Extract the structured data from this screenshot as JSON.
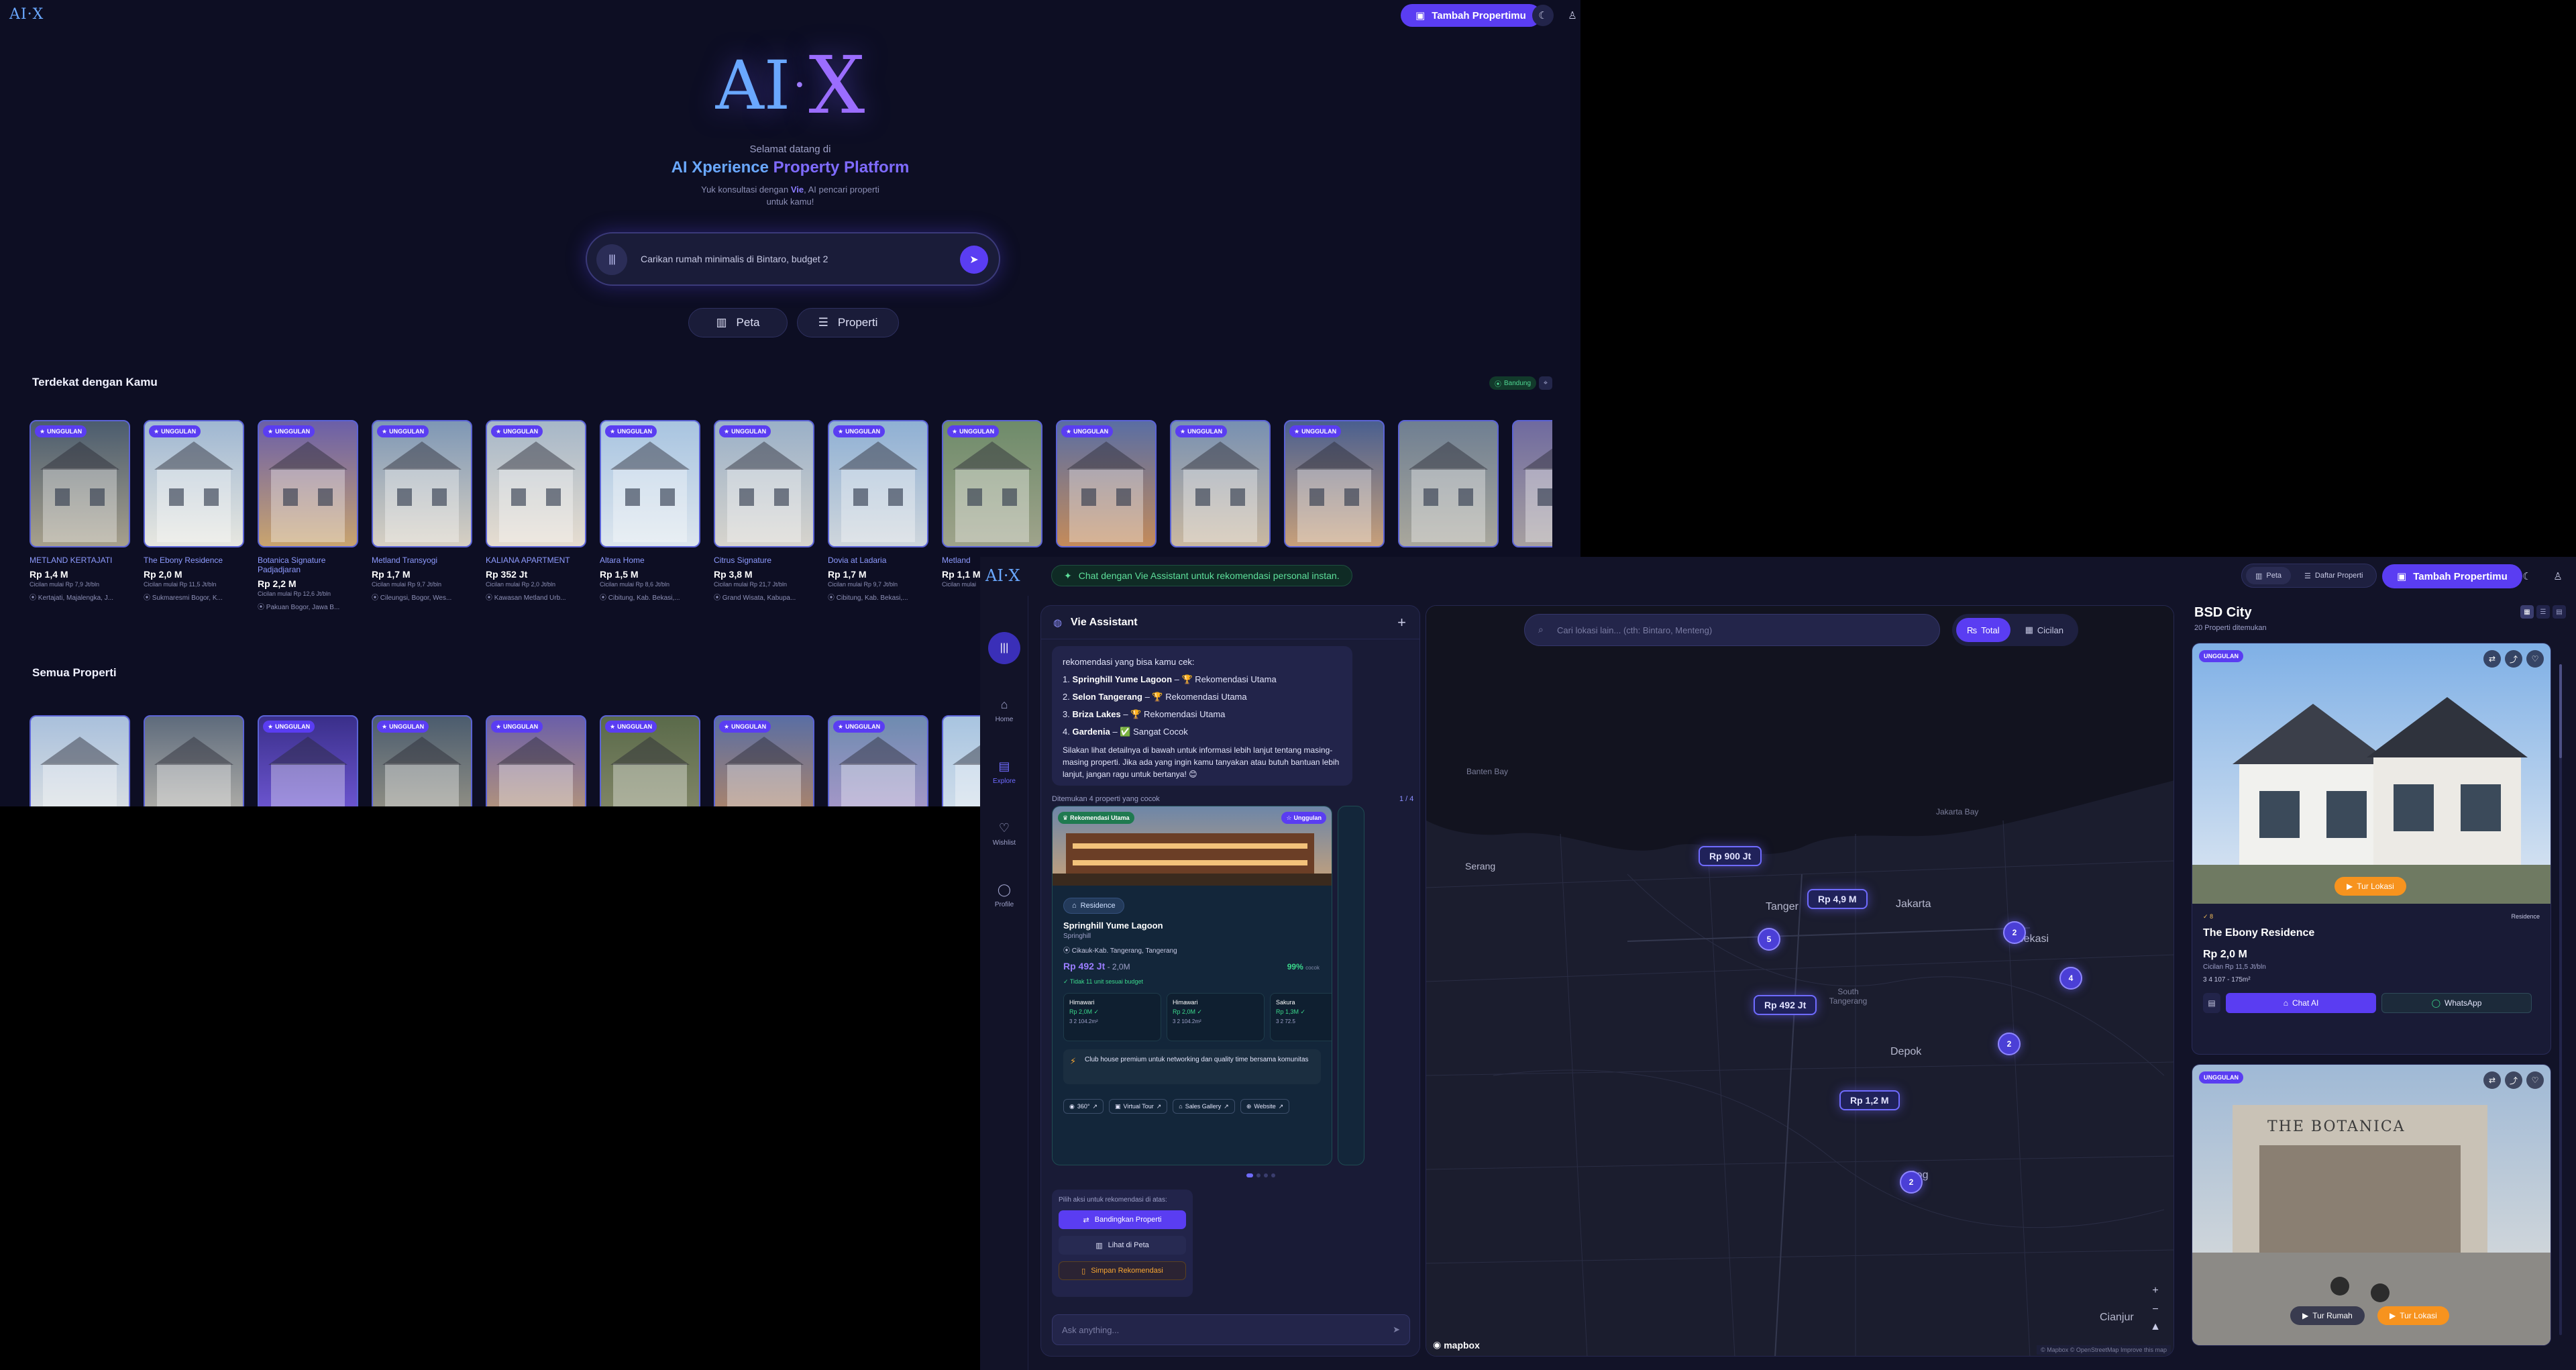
{
  "home": {
    "logo_small": "AI·X",
    "add_property": "Tambah Propertimu",
    "hero_logo_left": "AI",
    "hero_logo_right": "X",
    "welcome_line1": "Selamat datang di",
    "welcome_line2_a": "AI Xperience",
    "welcome_line2_b": " Property Platform",
    "welcome_line3_a": "Yuk konsultasi dengan ",
    "welcome_line3_vie": "Vie",
    "welcome_line3_b": ", AI pencari properti untuk kamu!",
    "search_placeholder": "Carikan rumah minimalis di Bintaro, budget 2",
    "map_button": "Peta",
    "property_button": "Properti",
    "nearby_title": "Terdekat dengan Kamu",
    "location_badge": "Bandung",
    "all_title": "Semua Properti",
    "nearby": [
      {
        "badge": "UNGGULAN",
        "name": "METLAND KERTAJATI",
        "price": "Rp 1,4 M",
        "inst": "Cicilan mulai Rp 7,9 Jt/bln",
        "loc": "Kertajati, Majalengka, J..."
      },
      {
        "badge": "UNGGULAN",
        "name": "The Ebony Residence",
        "price": "Rp 2,0 M",
        "inst": "Cicilan mulai Rp 11,5 Jt/bln",
        "loc": "Sukmaresmi Bogor, K..."
      },
      {
        "badge": "UNGGULAN",
        "name": "Botanica Signature Padjadjaran",
        "price": "Rp 2,2 M",
        "inst": "Cicilan mulai Rp 12,6 Jt/bln",
        "loc": "Pakuan Bogor, Jawa B..."
      },
      {
        "badge": "UNGGULAN",
        "name": "Metland Transyogi",
        "price": "Rp 1,7 M",
        "inst": "Cicilan mulai Rp 9,7 Jt/bln",
        "loc": "Cileungsi, Bogor, Wes..."
      },
      {
        "badge": "UNGGULAN",
        "name": "KALIANA APARTMENT",
        "price": "Rp 352 Jt",
        "inst": "Cicilan mulai Rp 2,0 Jt/bln",
        "loc": "Kawasan Metland Urb..."
      },
      {
        "badge": "UNGGULAN",
        "name": "Altara Home",
        "price": "Rp 1,5 M",
        "inst": "Cicilan mulai Rp 8,6 Jt/bln",
        "loc": "Cibitung, Kab. Bekasi,..."
      },
      {
        "badge": "UNGGULAN",
        "name": "Citrus Signature",
        "price": "Rp 3,8 M",
        "inst": "Cicilan mulai Rp 21,7 Jt/bln",
        "loc": "Grand Wisata, Kabupa..."
      },
      {
        "badge": "UNGGULAN",
        "name": "Dovia at Ladaria",
        "price": "Rp 1,7 M",
        "inst": "Cicilan mulai Rp 9,7 Jt/bln",
        "loc": "Cibitung, Kab. Bekasi,..."
      },
      {
        "badge": "UNGGULAN",
        "name": "Metland",
        "price": "Rp 1,1 M",
        "inst": "Cicilan mulai",
        "loc": ""
      },
      {
        "badge": "UNGGULAN",
        "name": "",
        "price": "",
        "inst": "",
        "loc": ""
      },
      {
        "badge": "UNGGULAN",
        "name": "",
        "price": "",
        "inst": "",
        "loc": ""
      },
      {
        "badge": "UNGGULAN",
        "name": "",
        "price": "",
        "inst": "",
        "loc": ""
      },
      {
        "badge": "",
        "name": "",
        "price": "",
        "inst": "",
        "loc": ""
      },
      {
        "badge": "",
        "name": "",
        "price": "",
        "inst": "",
        "loc": ""
      }
    ],
    "all": [
      {
        "badge": ""
      },
      {
        "badge": ""
      },
      {
        "badge": "UNGGULAN"
      },
      {
        "badge": "UNGGULAN"
      },
      {
        "badge": "UNGGULAN"
      },
      {
        "badge": "UNGGULAN"
      },
      {
        "badge": "UNGGULAN"
      },
      {
        "badge": "UNGGULAN"
      },
      {
        "badge": ""
      }
    ]
  },
  "map_app": {
    "logo": "AI·X",
    "vie_hint": "Chat dengan Vie Assistant untuk rekomendasi personal instan.",
    "view_map": "Peta",
    "view_list": "Daftar Properti",
    "add_property": "Tambah Propertimu",
    "nav": [
      {
        "label": "Home",
        "icon": "⌂"
      },
      {
        "label": "Explore",
        "icon": "▤"
      },
      {
        "label": "Wishlist",
        "icon": "♡"
      },
      {
        "label": "Profile",
        "icon": "◯"
      }
    ],
    "assistant_title": "Vie Assistant",
    "bubble_intro": "rekomendasi yang bisa kamu cek:",
    "recs": [
      {
        "n": "1.",
        "name": "Springhill Yume Lagoon",
        "tag": "– 🏆 Rekomendasi Utama"
      },
      {
        "n": "2.",
        "name": "Selon Tangerang",
        "tag": "– 🏆 Rekomendasi Utama"
      },
      {
        "n": "3.",
        "name": "Briza Lakes",
        "tag": "– 🏆 Rekomendasi Utama"
      },
      {
        "n": "4.",
        "name": "Gardenia",
        "tag": "– ✅ Sangat Cocok"
      }
    ],
    "bubble_outro": "Silakan lihat detailnya di bawah untuk informasi lebih lanjut tentang masing-masing properti. Jika ada yang ingin kamu tanyakan atau butuh bantuan lebih lanjut, jangan ragu untuk bertanya! 😊",
    "found_text": "Ditemukan 4 properti yang cocok",
    "found_count": "1 / 4",
    "card": {
      "rec_tag": "Rekomendasi Utama",
      "featured_tag": "Unggulan",
      "type": "Residence",
      "name": "Springhill Yume Lagoon",
      "developer": "Springhill",
      "location": "Cikauk-Kab. Tangerang, Tangerang",
      "price": "Rp 492 Jt",
      "price_max": " - 2,0M",
      "match": "99%",
      "match_lbl": "cocok",
      "budget": "✓ Tidak 11 unit sesuai budget",
      "units": [
        {
          "name": "Himawari",
          "price": "Rp 2,0M ✓",
          "spec": "3  2  104.2m²"
        },
        {
          "name": "Himawari",
          "price": "Rp 2,0M ✓",
          "spec": "3  2  104.2m²"
        },
        {
          "name": "Sakura",
          "price": "Rp 1,3M ✓",
          "spec": "3  2  72.5"
        }
      ],
      "highlight": "Club house premium untuk networking dan quality time bersama komunitas",
      "links": [
        "360°",
        "Virtual Tour",
        "Sales Gallery",
        "Website"
      ]
    },
    "actions_title": "Pilih aksi untuk rekomendasi di atas:",
    "action_compare": "Bandingkan Properti",
    "action_map": "Lihat di Peta",
    "action_save": "Simpan Rekomendasi",
    "ask_placeholder": "Ask anything...",
    "map_search_placeholder": "Cari lokasi lain... (cth: Bintaro, Menteng)",
    "toggle_total": "Total",
    "toggle_installment": "Cicilan",
    "pins": [
      "Rp 900 Jt",
      "Rp 4,9 M",
      "Rp 492 Jt",
      "Rp 1,2 M"
    ],
    "clusters": [
      "5",
      "2",
      "4",
      "2",
      "2"
    ],
    "map_labels": {
      "banten_bay": "Banten Bay",
      "serang": "Serang",
      "jakarta_bay": "Jakarta Bay",
      "tangerang": "Tanger",
      "jakarta": "Jakarta",
      "bekasi": "Bekasi",
      "south_tangerang": "South Tangerang",
      "depok": "Depok",
      "bogor": "Bog",
      "cianjur": "Cianjur"
    },
    "mapbox": "mapbox",
    "attribution": "© Mapbox © OpenStreetMap  Improve this map",
    "panel_title": "BSD City",
    "panel_sub": "20 Properti ditemukan",
    "result1": {
      "badge": "UNGGULAN",
      "tour": "Tur Lokasi",
      "chip": "✓ 8",
      "type": "Residence",
      "name": "The Ebony Residence",
      "price": "Rp 2,0 M",
      "inst": "Cicilan Rp 11,5 Jt/bln",
      "spec": "3   4   107 - 175m²",
      "chat": "Chat AI",
      "wa": "WhatsApp"
    },
    "result2": {
      "badge": "UNGGULAN",
      "tour_home": "Tur Rumah",
      "tour_loc": "Tur Lokasi",
      "sign": "THE BOTANICA"
    }
  }
}
